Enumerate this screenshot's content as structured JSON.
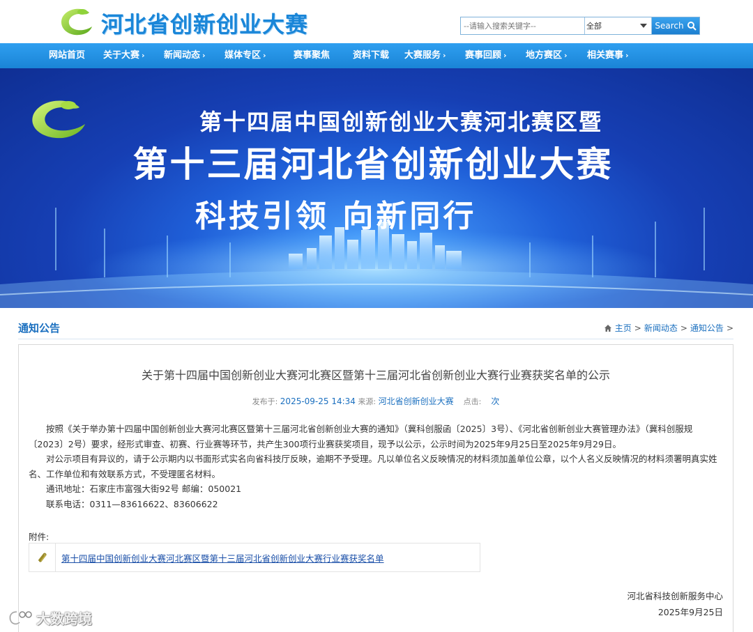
{
  "site": {
    "logo_text": "河北省创新创业大赛",
    "search_placeholder": "--请输入搜索关键字--",
    "search_scope": "全部",
    "search_button": "Search"
  },
  "nav": [
    {
      "label": "网站首页",
      "has_menu": false
    },
    {
      "label": "关于大赛",
      "has_menu": true
    },
    {
      "label": "新闻动态",
      "has_menu": true
    },
    {
      "label": "媒体专区",
      "has_menu": true
    },
    {
      "label": "赛事聚焦",
      "has_menu": false
    },
    {
      "label": "资料下载",
      "has_menu": false
    },
    {
      "label": "大赛服务",
      "has_menu": true
    },
    {
      "label": "赛事回顾",
      "has_menu": true
    },
    {
      "label": "地方赛区",
      "has_menu": true
    },
    {
      "label": "相关赛事",
      "has_menu": true
    }
  ],
  "nav_chevron": "›",
  "banner": {
    "line1": "第十四届中国创新创业大赛河北赛区暨",
    "line2": "第十三届河北省创新创业大赛",
    "line3": "科技引领  向新同行"
  },
  "section": {
    "title": "通知公告",
    "breadcrumb": [
      "主页",
      "新闻动态",
      "通知公告"
    ],
    "separator": ">"
  },
  "article": {
    "title": "关于第十四届中国创新创业大赛河北赛区暨第十三届河北省创新创业大赛行业赛获奖名单的公示",
    "meta_published_label": "发布于:",
    "meta_published": "2025-09-25 14:34",
    "meta_source_label": "来源:",
    "meta_source": "河北省创新创业大赛",
    "meta_clicks_label": "点击:",
    "meta_clicks_unit": "次",
    "paragraphs": [
      "按照《关于举办第十四届中国创新创业大赛河北赛区暨第十三届河北省创新创业大赛的通知》（冀科创服函〔2025〕3号）、《河北省创新创业大赛管理办法》（冀科创服规〔2023〕2号）要求，经形式审查、初赛、行业赛等环节，共产生300项行业赛获奖项目，现予以公示，公示时间为2025年9月25日至2025年9月29日。",
      "对公示项目有异议的，请于公示期内以书面形式实名向省科技厅反映，逾期不予受理。凡以单位名义反映情况的材料须加盖单位公章，以个人名义反映情况的材料须署明真实姓名、工作单位和有效联系方式，不受理匿名材料。",
      "通讯地址：石家庄市富强大街92号    邮编：050021",
      "联系电话：0311—83616622、83606622"
    ],
    "attachment_label": "附件:",
    "attachment_link": "第十四届中国创新创业大赛河北赛区暨第十三届河北省创新创业大赛行业赛获奖名单",
    "sign_org": "河北省科技创新服务中心",
    "sign_date": "2025年9月25日"
  },
  "watermark": "大数跨境",
  "colors": {
    "nav_blue": "#1a84d6",
    "link_blue": "#1a6fbf",
    "logo_green": "#7cc22a"
  }
}
